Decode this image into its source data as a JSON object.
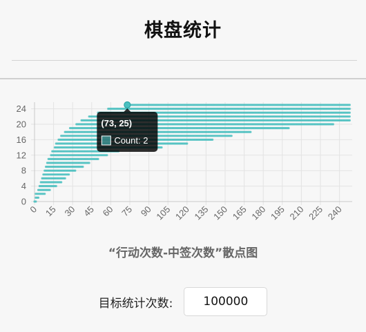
{
  "page": {
    "title": "棋盘统计",
    "input_label": "目标统计次数:",
    "input_value": "100000"
  },
  "chart_data": {
    "type": "scatter",
    "title": "“行动次数-中签次数”散点图",
    "xlabel": "",
    "ylabel": "",
    "xlim": [
      0,
      250
    ],
    "ylim": [
      0,
      25
    ],
    "x_ticks": [
      0,
      15,
      30,
      45,
      60,
      75,
      90,
      105,
      120,
      135,
      150,
      165,
      180,
      195,
      210,
      225,
      240
    ],
    "y_ticks": [
      0,
      4,
      8,
      12,
      16,
      20,
      24
    ],
    "grid": true,
    "legend": "none",
    "point_color": "#4bc0c0",
    "series": [
      {
        "y_ranges": [
          {
            "y": 0,
            "x": [
              0,
              1
            ]
          },
          {
            "y": 1,
            "x": [
              1,
              3
            ]
          },
          {
            "y": 2,
            "x": [
              1,
              8
            ]
          },
          {
            "y": 3,
            "x": [
              3,
              12
            ]
          },
          {
            "y": 4,
            "x": [
              4,
              17
            ]
          },
          {
            "y": 5,
            "x": [
              5,
              21
            ]
          },
          {
            "y": 6,
            "x": [
              6,
              24
            ]
          },
          {
            "y": 7,
            "x": [
              7,
              27
            ]
          },
          {
            "y": 8,
            "x": [
              8,
              32
            ]
          },
          {
            "y": 9,
            "x": [
              9,
              38
            ]
          },
          {
            "y": 10,
            "x": [
              10,
              43
            ]
          },
          {
            "y": 11,
            "x": [
              11,
              50
            ]
          },
          {
            "y": 12,
            "x": [
              13,
              57
            ]
          },
          {
            "y": 13,
            "x": [
              14,
              66
            ]
          },
          {
            "y": 14,
            "x": [
              16,
              100
            ]
          },
          {
            "y": 15,
            "x": [
              17,
              120
            ]
          },
          {
            "y": 16,
            "x": [
              19,
              140
            ]
          },
          {
            "y": 17,
            "x": [
              21,
              155
            ]
          },
          {
            "y": 18,
            "x": [
              24,
              170
            ]
          },
          {
            "y": 19,
            "x": [
              28,
              200
            ]
          },
          {
            "y": 20,
            "x": [
              33,
              235
            ]
          },
          {
            "y": 21,
            "x": [
              37,
              248
            ]
          },
          {
            "y": 22,
            "x": [
              43,
              248
            ]
          },
          {
            "y": 23,
            "x": [
              50,
              248
            ]
          },
          {
            "y": 24,
            "x": [
              58,
              248
            ]
          },
          {
            "y": 25,
            "x": [
              73,
              248
            ]
          }
        ]
      }
    ],
    "tooltip": {
      "title": "(73, 25)",
      "label": "Count: 2",
      "point": {
        "x": 73,
        "y": 25
      }
    }
  }
}
